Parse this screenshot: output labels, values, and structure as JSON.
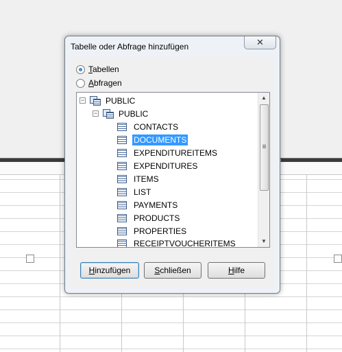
{
  "dialog": {
    "title": "Tabelle oder Abfrage hinzufügen",
    "close_glyph": "✕",
    "options": [
      {
        "label": "Tabellen",
        "accesskey": "T",
        "rest": "abellen",
        "checked": true
      },
      {
        "label": "Abfragen",
        "accesskey": "A",
        "rest": "bfragen",
        "checked": false
      }
    ],
    "tree": {
      "schema_root": "PUBLIC",
      "schema_child": "PUBLIC",
      "tables": [
        "CONTACTS",
        "DOCUMENTS",
        "EXPENDITUREITEMS",
        "EXPENDITURES",
        "ITEMS",
        "LIST",
        "PAYMENTS",
        "PRODUCTS",
        "PROPERTIES",
        "RECEIPTVOUCHERITEMS"
      ],
      "selected": "DOCUMENTS",
      "expander_glyph": "−"
    },
    "buttons": {
      "add": {
        "label": "Hinzufügen",
        "accesskey": "H",
        "rest": "inzufügen"
      },
      "close": {
        "label": "Schließen",
        "accesskey": "S",
        "rest": "chließen"
      },
      "help": {
        "label": "Hilfe",
        "accesskey": "H",
        "rest": "ilfe"
      }
    }
  },
  "colors": {
    "selection": "#3399ff",
    "dialog_frame": "#eef2f7",
    "separator": "#3b3b3b"
  }
}
